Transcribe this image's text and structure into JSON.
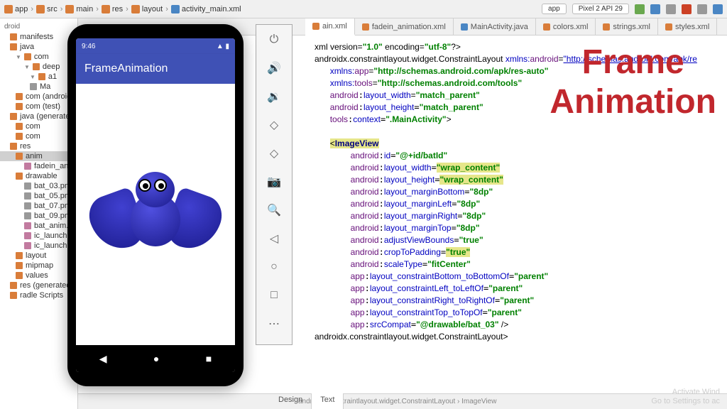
{
  "breadcrumbs": [
    "app",
    "src",
    "main",
    "res",
    "layout",
    "activity_main.xml"
  ],
  "toolbar_right": {
    "app": "app",
    "device": "Pixel 2 API 29"
  },
  "project_header": "droid",
  "tree": {
    "n1": "manifests",
    "n2": "java",
    "n3": "com",
    "n4": "deep",
    "n5": "a1",
    "n6": "Ma",
    "n7": "com (android",
    "n8": "com (test)",
    "n9": "java (generated)",
    "n10": "com",
    "n11": "com",
    "n12": "res",
    "n13": "anim",
    "n14": "fadein_an",
    "n15": "drawable",
    "n16": "bat_03.pn",
    "n17": "bat_05.pn",
    "n18": "bat_07.pn",
    "n19": "bat_09.pn",
    "n20": "bat_anim.",
    "n21": "ic_launche",
    "n22": "ic_launche",
    "n23": "layout",
    "n24": "mipmap",
    "n25": "values",
    "n26": "res (generated)",
    "n27": "radle Scripts"
  },
  "tabs": {
    "t1": "ain.xml",
    "t2": "fadein_animation.xml",
    "t3": "MainActivity.java",
    "t4": "colors.xml",
    "t5": "strings.xml",
    "t6": "styles.xml"
  },
  "code": {
    "l1a": "xml version=",
    "l1b": "\"1.0\"",
    "l1c": " encoding=",
    "l1d": "\"utf-8\"",
    "l1e": "?>",
    "l2a": "androidx.constraintlayout.widget.ConstraintLayout ",
    "l2b": "xmlns:",
    "l2c": "android",
    "l2d": "=",
    "l2e": "\"http://schemas.android.com/apk/re",
    "l3a": "xmlns:",
    "l3b": "app",
    "l3c": "=",
    "l3d": "\"http://schemas.android.com/apk/res-auto\"",
    "l4a": "xmlns:",
    "l4b": "tools",
    "l4c": "=",
    "l4d": "\"http://schemas.android.com/tools\"",
    "l5a": "android",
    ":l5b": ":",
    "l5c": "layout_width",
    "l5d": "=",
    "l5e": "\"match_parent\"",
    "l6a": "android",
    "l6c": "layout_height",
    "l6e": "\"match_parent\"",
    "l7a": "tools",
    "l7c": "context",
    "l7e": "\".MainActivity\"",
    "l7f": ">",
    "l9a": "<",
    "l9b": "ImageView",
    "l10a": "android",
    "l10c": "id",
    "l10e": "\"@+id/batId\"",
    "l11a": "android",
    "l11c": "layout_width",
    "l11e": "\"wrap_content\"",
    "l12a": "android",
    "l12c": "layout_height",
    "l12e": "\"wrap_content\"",
    "l13a": "android",
    "l13c": "layout_marginBottom",
    "l13e": "\"8dp\"",
    "l14a": "android",
    "l14c": "layout_marginLeft",
    "l14e": "\"8dp\"",
    "l15a": "android",
    "l15c": "layout_marginRight",
    "l15e": "\"8dp\"",
    "l16a": "android",
    "l16c": "layout_marginTop",
    "l16e": "\"8dp\"",
    "l17a": "android",
    "l17c": "adjustViewBounds",
    "l17e": "\"true\"",
    "l18a": "android",
    "l18c": "cropToPadding",
    "l18e": "\"true\"",
    "l19a": "android",
    "l19c": "scaleType",
    "l19e": "\"fitCenter\"",
    "l20a": "app",
    "l20c": "layout_constraintBottom_toBottomOf",
    "l20e": "\"parent\"",
    "l21a": "app",
    "l21c": "layout_constraintLeft_toLeftOf",
    "l21e": "\"parent\"",
    "l22a": "app",
    "l22c": "layout_constraintRight_toRightOf",
    "l22e": "\"parent\"",
    "l23a": "app",
    "l23c": "layout_constraintTop_toTopOf",
    "l23e": "\"parent\"",
    "l24a": "app",
    "l24c": "srcCompat",
    "l24e": "\"@drawable/bat_03\"",
    "l24f": " />",
    "l25": "androidx.constraintlayout.widget.ConstraintLayout>"
  },
  "bottom": {
    "design": "Design",
    "text": "Text",
    "bc": "androidx.constraintlayout.widget.ConstraintLayout  ›  ImageView"
  },
  "overlay": {
    "l1": "Frame",
    "l2": "Animation"
  },
  "phone": {
    "time": "9:46",
    "app_title": "FrameAnimation"
  },
  "watermark": {
    "l1": "Activate Wind",
    "l2": "Go to Settings to ac"
  }
}
